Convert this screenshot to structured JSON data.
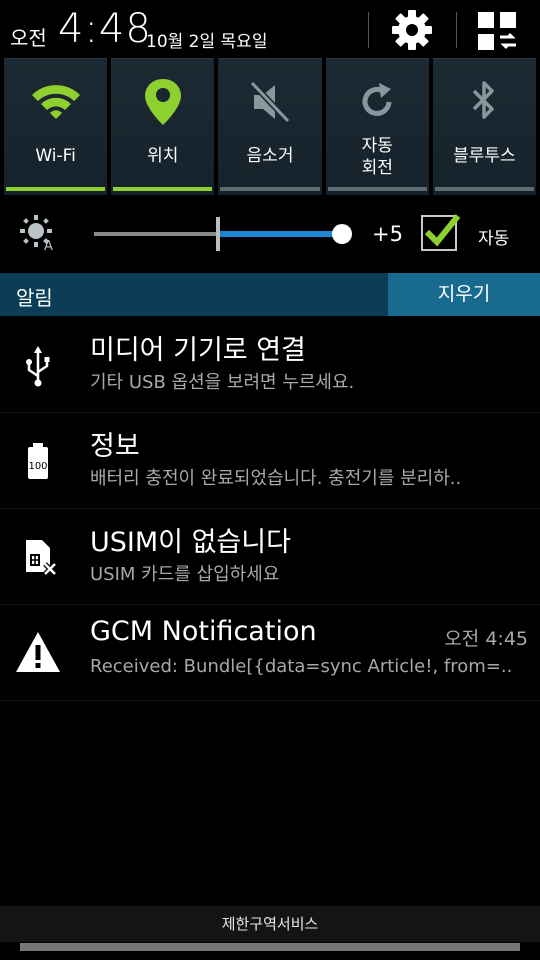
{
  "header": {
    "ampm": "오전",
    "time": "4:48",
    "date": "10월 2일 목요일",
    "settings_icon": "gear-icon",
    "grid_icon": "grid-icon"
  },
  "quick_settings": [
    {
      "label": "Wi-Fi",
      "icon": "wifi-icon",
      "active": true
    },
    {
      "label": "위치",
      "icon": "location-icon",
      "active": true
    },
    {
      "label": "음소거",
      "icon": "mute-icon",
      "active": false
    },
    {
      "label_line1": "자동",
      "label_line2": "회전",
      "icon": "rotate-icon",
      "active": false
    },
    {
      "label": "블루투스",
      "icon": "bluetooth-icon",
      "active": false
    }
  ],
  "brightness": {
    "level_text": "+5",
    "auto_label": "자동",
    "auto_checked": true,
    "level_fraction": 1.0,
    "auto_marker_fraction": 0.5
  },
  "notifications_panel": {
    "title": "알림",
    "clear_label": "지우기",
    "items": [
      {
        "title": "미디어 기기로 연결",
        "subtitle": "기타 USB 옵션을 보려면 누르세요.",
        "icon": "usb-icon",
        "time": ""
      },
      {
        "title": "정보",
        "subtitle": "배터리 충전이 완료되었습니다. 충전기를 분리하..",
        "icon": "battery-full-icon",
        "time": "",
        "icon_text": "100"
      },
      {
        "title": "USIM이 없습니다",
        "subtitle": "USIM 카드를 삽입하세요",
        "icon": "no-sim-icon",
        "time": ""
      },
      {
        "title": "GCM Notification",
        "subtitle": "Received: Bundle[{data=sync Article!, from=..",
        "icon": "warning-icon",
        "time": "오전 4:45"
      }
    ]
  },
  "footer": {
    "carrier_text": "제한구역서비스"
  },
  "colors": {
    "active_green": "#8fd031",
    "slider_blue": "#1c86d4",
    "notif_header": "#0b3d56",
    "clear_button": "#186a8f"
  }
}
